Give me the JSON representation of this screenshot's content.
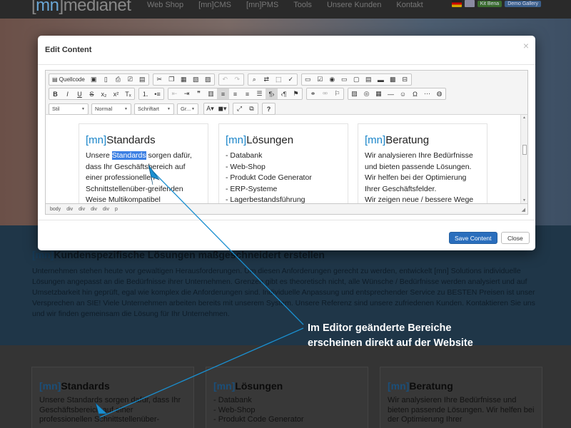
{
  "site": {
    "logo": {
      "bracket_open": "[",
      "mn": "mn",
      "bracket_close": "]",
      "brand": "medianet"
    },
    "nav": [
      "Web Shop",
      "[mn]CMS",
      "[mn]PMS",
      "Tools",
      "Unsere Kunden",
      "Kontakt"
    ],
    "header_buttons": [
      "Kit Bena",
      "Demo Gallery"
    ],
    "section_title": {
      "prefix": "[mn]",
      "text": "Kundenspezifische Lösungen maßgeschneidert erstellen"
    },
    "section_text": "Unternehmen stehen heute vor gewaltigen Herausforderungen. Um diesen Anforderungen gerecht zu werden, entwickelt [mn] Solutions individuelle Lösungen angepasst an die Bedürfnisse ihrer Unternehmen. Grenzen gibt es theoretisch nicht, alle Wünsche / Bedürfnisse werden analysiert und auf Umsetzbarkeit hin geprüft, egal wie komplex die Anforderungen sind. Individuelle Anpassung und entsprechender Service zu BESTEN Preisen ist unser Versprechen an SIE! Viele Unternehmen arbeiten bereits mit unserem System. Unsere Referenz sind unsere zufriedenen Kunden. Kontaktieren Sie uns und wir finden gemeinsam die Lösung für Ihr Unternehmen.",
    "cards": [
      {
        "prefix": "[mn]",
        "title": "Standards",
        "text": "Unsere Standards sorgen dafür, dass Ihr Geschäftsbereich auf einer professionellen Schnittstellenüber-"
      },
      {
        "prefix": "[mn]",
        "title": "Lösungen",
        "text": "- Databank\n- Web-Shop\n- Produkt Code Generator"
      },
      {
        "prefix": "[mn]",
        "title": "Beratung",
        "text": "Wir analysieren Ihre Bedürfnisse und bieten passende Lösungen. Wir helfen bei der Optimierung Ihrer"
      }
    ]
  },
  "modal": {
    "title": "Edit Content",
    "close_glyph": "×",
    "toolbar": {
      "source_label": "Quellcode",
      "combos": [
        "Stil",
        "Normal",
        "Schriftart",
        "Gr..."
      ]
    },
    "cards": [
      {
        "prefix": "[mn]",
        "title": "Standards",
        "lines": [
          "Unsere ",
          "Standards",
          " sorgen dafür,",
          "dass Ihr Geschäftsbereich auf",
          "einer professionellen",
          "Schnittstellenüber-greifenden",
          "Weise Multikompatibel"
        ]
      },
      {
        "prefix": "[mn]",
        "title": "Lösungen",
        "lines": [
          "- Databank",
          "- Web-Shop",
          "- Produkt Code Generator",
          "- ERP-Systeme",
          "- Lagerbestandsführung"
        ]
      },
      {
        "prefix": "[mn]",
        "title": "Beratung",
        "lines": [
          "Wir analysieren Ihre Bedürfnisse",
          "und bieten passende Lösungen.",
          "Wir helfen bei der Optimierung",
          "Ihrer Geschäftsfelder.",
          "Wir zeigen neue / bessere Wege"
        ]
      }
    ],
    "path": [
      "body",
      "div",
      "div",
      "div",
      "div",
      "p"
    ],
    "save_label": "Save Content",
    "close_label": "Close"
  },
  "annotation": {
    "line1": "Im Editor geänderte Bereiche",
    "line2": "erscheinen direkt auf der Website",
    "color": "#1a8fd0"
  }
}
